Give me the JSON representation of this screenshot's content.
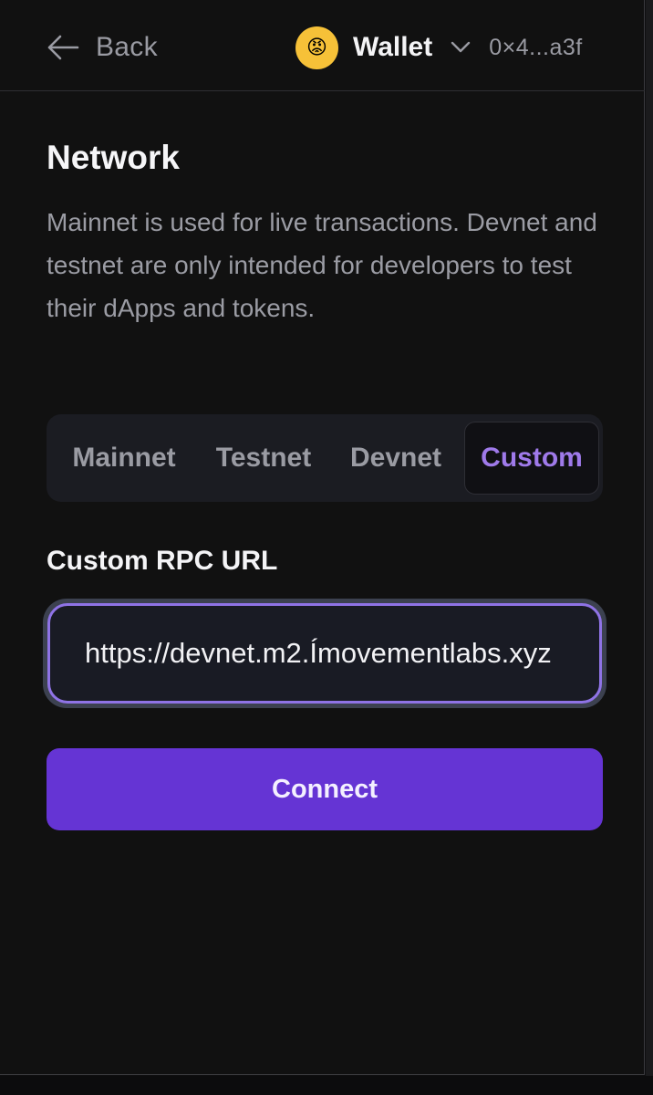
{
  "header": {
    "back_label": "Back",
    "back_icon": "arrow-left-icon",
    "wallet_avatar": "😡",
    "wallet_avatar_icon": "angry-face-avatar",
    "wallet_name": "Wallet",
    "dropdown_icon": "chevron-down-icon",
    "address": "0×4...a3f"
  },
  "network": {
    "title": "Network",
    "description": "Mainnet is used for live transactions. Devnet and testnet are only intended for developers to test their dApps and tokens.",
    "options": [
      {
        "label": "Mainnet",
        "selected": false
      },
      {
        "label": "Testnet",
        "selected": false
      },
      {
        "label": "Devnet",
        "selected": false
      },
      {
        "label": "Custom",
        "selected": true
      }
    ]
  },
  "custom_rpc": {
    "label": "Custom RPC URL",
    "value": "https://devnet.m2.Ímovementlabs.xyz"
  },
  "connect_button": {
    "label": "Connect"
  },
  "colors": {
    "background": "#111111",
    "accent": "#9f7aea",
    "primary_button": "#6534d4",
    "avatar": "#f6c138",
    "muted_text": "#9a9ba3"
  }
}
